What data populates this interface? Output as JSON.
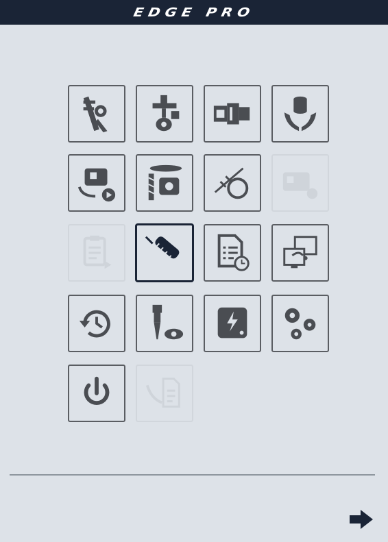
{
  "header": {
    "title": "EDGE PRO"
  },
  "colors": {
    "header_bg": "#1a2436",
    "icon": "#4a4d52",
    "background": "#dde2e8"
  },
  "menu": {
    "items": [
      {
        "icon": "caliper-wrench-icon",
        "state": "enabled"
      },
      {
        "icon": "spindle-probe-icon",
        "state": "enabled"
      },
      {
        "icon": "tool-holder-icon",
        "state": "enabled"
      },
      {
        "icon": "hands-coins-icon",
        "state": "enabled"
      },
      {
        "icon": "tool-change-cycle-icon",
        "state": "enabled"
      },
      {
        "icon": "endmill-cutter-icon",
        "state": "enabled"
      },
      {
        "icon": "circle-probe-icon",
        "state": "enabled"
      },
      {
        "icon": "tool-holder-disabled-icon",
        "state": "disabled"
      },
      {
        "icon": "clipboard-report-icon",
        "state": "disabled"
      },
      {
        "icon": "sensor-probe-icon",
        "state": "selected"
      },
      {
        "icon": "document-timer-icon",
        "state": "enabled"
      },
      {
        "icon": "remote-display-icon",
        "state": "enabled"
      },
      {
        "icon": "history-clock-icon",
        "state": "enabled"
      },
      {
        "icon": "tool-inspect-icon",
        "state": "enabled"
      },
      {
        "icon": "drive-power-icon",
        "state": "enabled"
      },
      {
        "icon": "settings-gears-icon",
        "state": "enabled"
      },
      {
        "icon": "power-icon",
        "state": "enabled"
      },
      {
        "icon": "document-transfer-icon",
        "state": "disabled"
      }
    ]
  },
  "footer": {
    "next_icon": "arrow-right-icon"
  }
}
